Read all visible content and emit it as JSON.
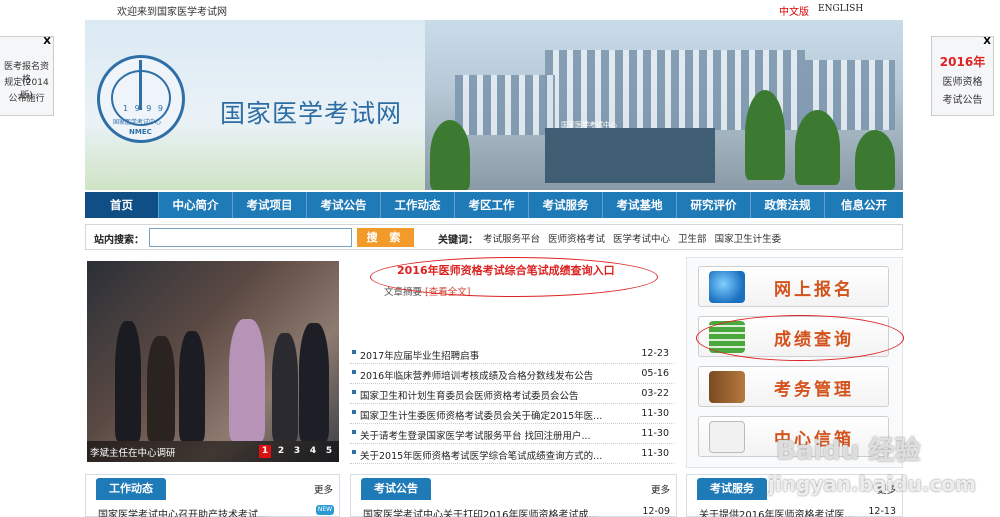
{
  "topbar": {
    "welcome": "欢迎来到国家医学考试网",
    "lang_cn": "中文版",
    "lang_en": "ENGLISH"
  },
  "banner": {
    "site_name": "国家医学考试网",
    "logo_year": "1 9 9 9",
    "logo_cn": "国家医学考试中心",
    "logo_en": "NMEC",
    "gate_label": "国家医学考试中心"
  },
  "nav": {
    "items": [
      "首页",
      "中心简介",
      "考试项目",
      "考试公告",
      "工作动态",
      "考区工作",
      "考试服务",
      "考试基地",
      "研究评价",
      "政策法规",
      "信息公开"
    ]
  },
  "search": {
    "label": "站内搜索：",
    "button": "搜 索",
    "keywords_label": "关键词：",
    "keywords": [
      "考试服务平台",
      "医师资格考试",
      "医学考试中心",
      "卫生部",
      "国家卫生计生委"
    ]
  },
  "slider": {
    "caption": "李斌主任在中心调研",
    "pages": [
      "1",
      "2",
      "3",
      "4",
      "5"
    ],
    "active_page": "1"
  },
  "headline": {
    "title": "2016年医师资格考试综合笔试成绩查询入口",
    "summary_prefix": "文章摘要",
    "summary_link": "[查看全文]"
  },
  "news": [
    {
      "title": "2017年应届毕业生招聘启事",
      "date": "12-23"
    },
    {
      "title": "2016年临床营养师培训考核成绩及合格分数线发布公告",
      "date": "05-16"
    },
    {
      "title": "国家卫生和计划生育委员会医师资格考试委员会公告",
      "date": "03-22"
    },
    {
      "title": "国家卫生计生委医师资格考试委员会关于确定2015年医...",
      "date": "11-30"
    },
    {
      "title": "关于请考生登录国家医学考试服务平台 找回注册用户...",
      "date": "11-30"
    },
    {
      "title": "关于2015年医师资格考试医学综合笔试成绩查询方式的...",
      "date": "11-30"
    }
  ],
  "services": [
    {
      "label": "网上报名",
      "icon": "globe-icon"
    },
    {
      "label": "成绩查询",
      "icon": "spreadsheet-icon"
    },
    {
      "label": "考务管理",
      "icon": "address-book-icon"
    },
    {
      "label": "中心信箱",
      "icon": "mail-icon"
    }
  ],
  "side_ad_left": {
    "close": "X",
    "lines": [
      "医考报名资格",
      "规定(2014版)",
      "公布施行"
    ]
  },
  "side_ad_right": {
    "close": "X",
    "lines": [
      "2016年",
      "医师资格",
      "考试公告"
    ]
  },
  "panels": [
    {
      "tab": "工作动态",
      "more": "更多",
      "item": "国家医学考试中心召开助产技术考试...",
      "date": "",
      "new_badge": "NEW"
    },
    {
      "tab": "考试公告",
      "more": "更多",
      "item": "国家医学考试中心关于打印2016年医师资格考试成...",
      "date": "12-09"
    },
    {
      "tab": "考试服务",
      "more": "更多",
      "item": "关于提供2016年医师资格考试医...",
      "date": "12-13"
    }
  ],
  "watermark": {
    "brand": "Baidu 经验",
    "url": "jingyan.baidu.com"
  },
  "colors": {
    "nav_blue": "#1f7ab8",
    "nav_active": "#0f4f86",
    "accent_red": "#d22",
    "search_orange": "#f39b2a",
    "service_orange": "#d4521c"
  }
}
